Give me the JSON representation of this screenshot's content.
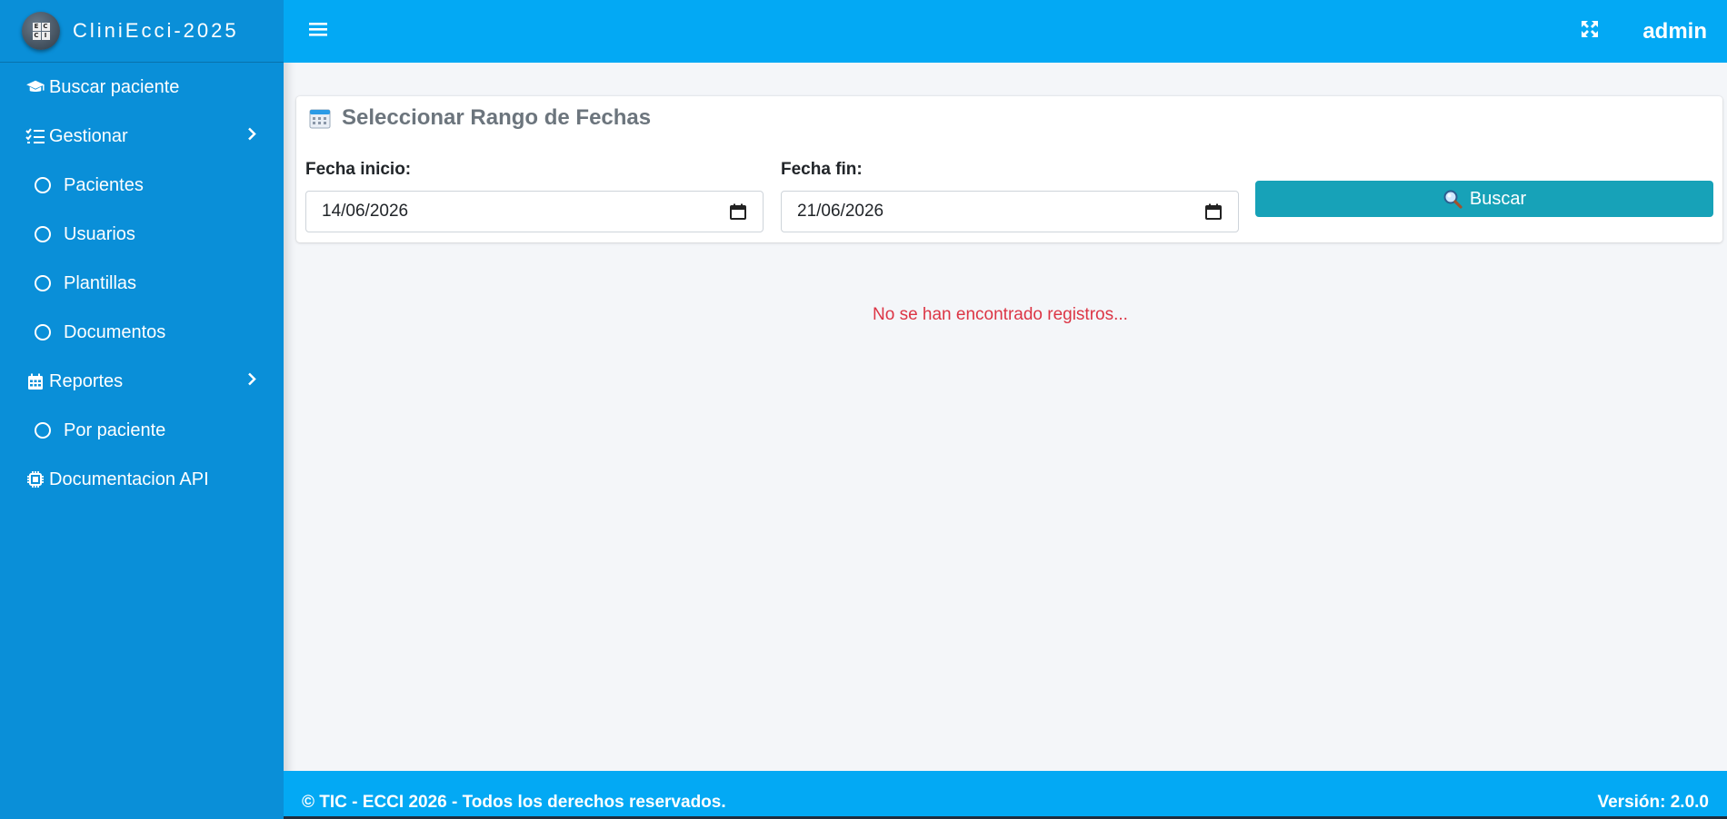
{
  "brand": {
    "name": "CliniEcci-2025",
    "logo_letters": [
      "E",
      "C",
      "C",
      "I"
    ]
  },
  "sidebar": {
    "items": [
      {
        "label": "Buscar paciente",
        "icon": "graduation-cap-icon"
      },
      {
        "label": "Gestionar",
        "icon": "list-check-icon"
      },
      {
        "label": "Pacientes",
        "icon": "circle-icon"
      },
      {
        "label": "Usuarios",
        "icon": "circle-icon"
      },
      {
        "label": "Plantillas",
        "icon": "circle-icon"
      },
      {
        "label": "Documentos",
        "icon": "circle-icon"
      },
      {
        "label": "Reportes",
        "icon": "calendar-icon"
      },
      {
        "label": "Por paciente",
        "icon": "circle-icon"
      },
      {
        "label": "Documentacion API",
        "icon": "microchip-icon"
      }
    ]
  },
  "topbar": {
    "user": "admin"
  },
  "card": {
    "title": "Seleccionar Rango de Fechas",
    "start_label": "Fecha inicio:",
    "start_value": "14/06/2026",
    "end_label": "Fecha fin:",
    "end_value": "21/06/2026",
    "search_label": "Buscar"
  },
  "results": {
    "empty_message": "No se han encontrado registros..."
  },
  "footer": {
    "copyright": "© TIC - ECCI 2026 - Todos los derechos reservados.",
    "version": "Versión: 2.0.0"
  },
  "colors": {
    "sidebar": "#0a8fd8",
    "topbar": "#03a9f4",
    "button": "#17a2b8",
    "empty_text": "#dc3545"
  }
}
